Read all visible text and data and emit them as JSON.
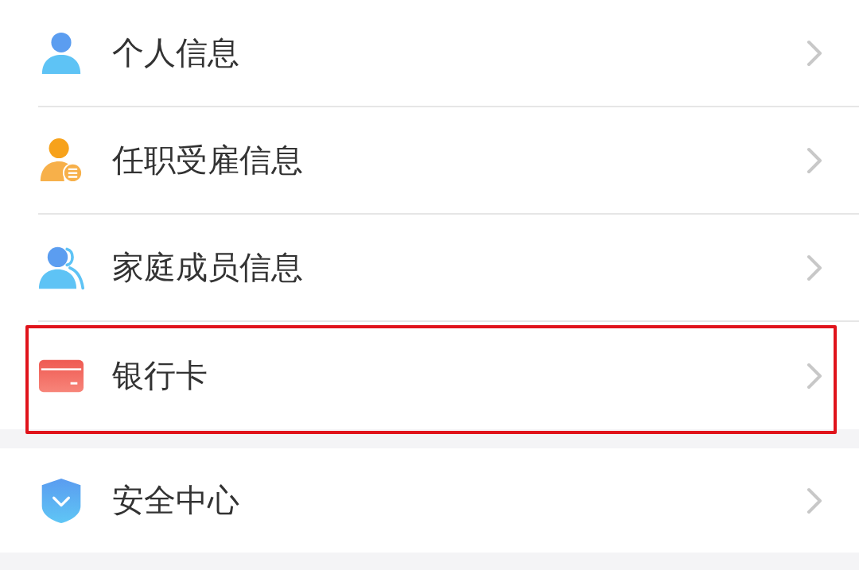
{
  "sections": [
    {
      "items": [
        {
          "label": "个人信息",
          "kind": "person",
          "highlighted": false
        },
        {
          "label": "任职受雇信息",
          "kind": "employee",
          "highlighted": false
        },
        {
          "label": "家庭成员信息",
          "kind": "family",
          "highlighted": false
        },
        {
          "label": "银行卡",
          "kind": "card",
          "highlighted": true
        }
      ]
    },
    {
      "items": [
        {
          "label": "安全中心",
          "kind": "security",
          "highlighted": false
        }
      ]
    }
  ]
}
